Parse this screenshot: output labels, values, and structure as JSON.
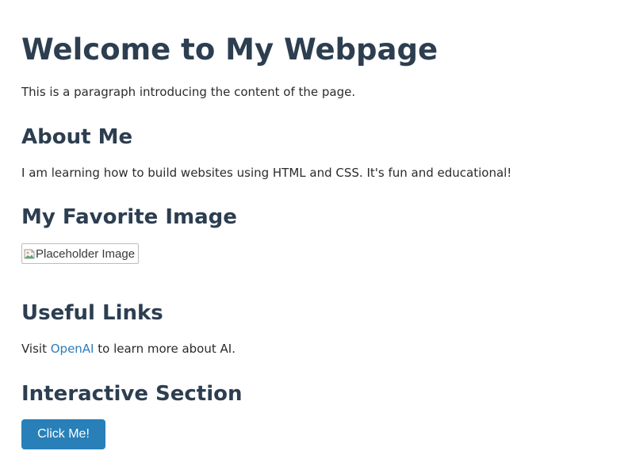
{
  "heading": "Welcome to My Webpage",
  "intro": "This is a paragraph introducing the content of the page.",
  "about": {
    "title": "About Me",
    "text": "I am learning how to build websites using HTML and CSS. It's fun and educational!"
  },
  "favorite": {
    "title": "My Favorite Image",
    "image_alt": "Placeholder Image"
  },
  "links": {
    "title": "Useful Links",
    "prefix": "Visit ",
    "link_text": "OpenAI",
    "suffix": " to learn more about AI."
  },
  "interactive": {
    "title": "Interactive Section",
    "button_label": "Click Me!"
  },
  "colors": {
    "heading": "#2c3e50",
    "link": "#2e7cb8",
    "button": "#2980b9"
  }
}
